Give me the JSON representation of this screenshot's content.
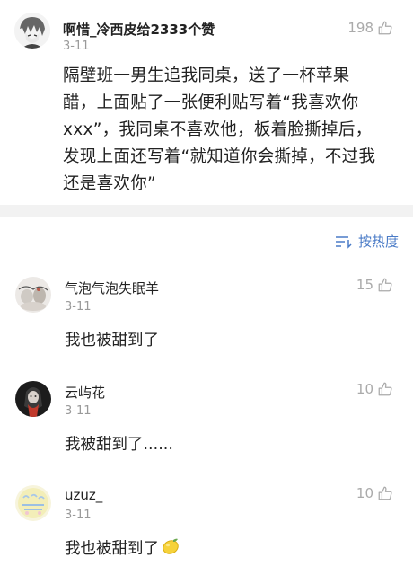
{
  "post": {
    "username": "啊惜_冷西皮给2333个赞",
    "date": "3-11",
    "likes": "198",
    "content_lines": [
      "隔壁班一男生追我同桌，送了一杯苹果",
      "醋，上面贴了一张便利贴写着“我喜欢你",
      "xxx”，我同桌不喜欢他，板着脸撕掉后，",
      "发现上面还写着“就知道你会撕掉，不过我",
      "还是喜欢你”"
    ]
  },
  "sort": {
    "label": "按热度",
    "icon": "sort-lines-icon"
  },
  "comments": [
    {
      "username": "气泡气泡失眠羊",
      "date": "3-11",
      "likes": "15",
      "text": "我也被甜到了"
    },
    {
      "username": "云屿花",
      "date": "3-11",
      "likes": "10",
      "text": "我被甜到了......"
    },
    {
      "username": "uzuz_",
      "date": "3-11",
      "likes": "10",
      "text": "我也被甜到了"
    }
  ],
  "colors": {
    "accent": "#4a7bc7",
    "muted": "#9a9a9a",
    "divider": "#f2f2f2"
  }
}
